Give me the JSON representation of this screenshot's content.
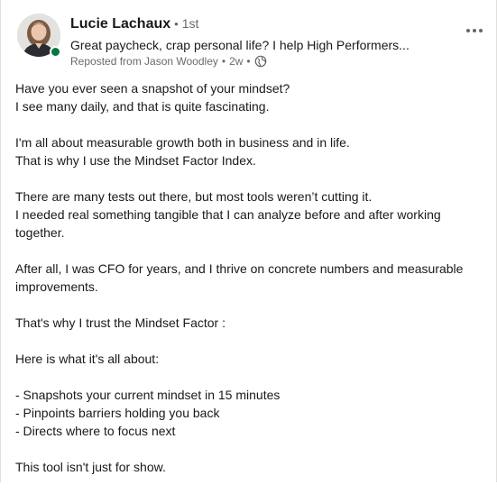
{
  "post": {
    "author": {
      "name": "Lucie Lachaux",
      "separator": "•",
      "degree": "1st",
      "headline": "Great paycheck, crap personal life? I help High Performers...",
      "presence_color": "#057642"
    },
    "meta": {
      "reposted": "Reposted from Jason Woodley",
      "separator": "•",
      "time": "2w",
      "separator2": "•",
      "visibility_icon": "globe-icon"
    },
    "more_icon": "ellipsis-icon",
    "paragraphs": [
      [
        "Have you ever seen a snapshot of your mindset?",
        "I see many daily, and that is quite fascinating."
      ],
      [
        "I'm all about measurable growth both in business and in life.",
        "That is why I use the Mindset Factor Index."
      ],
      [
        "There are many tests out there, but most tools weren’t cutting it.",
        "I needed real something tangible that I can analyze before and after working",
        "together."
      ],
      [
        "After all, I was CFO for years, and I thrive on concrete numbers and measurable",
        "improvements."
      ],
      [
        "That's why I trust the Mindset Factor :"
      ],
      [
        "Here is what it's all about:"
      ],
      [
        "- Snapshots your current mindset in 15 minutes",
        "- Pinpoints barriers holding you back",
        "- Directs where to focus next"
      ],
      [
        "This tool isn't just for show."
      ]
    ]
  }
}
